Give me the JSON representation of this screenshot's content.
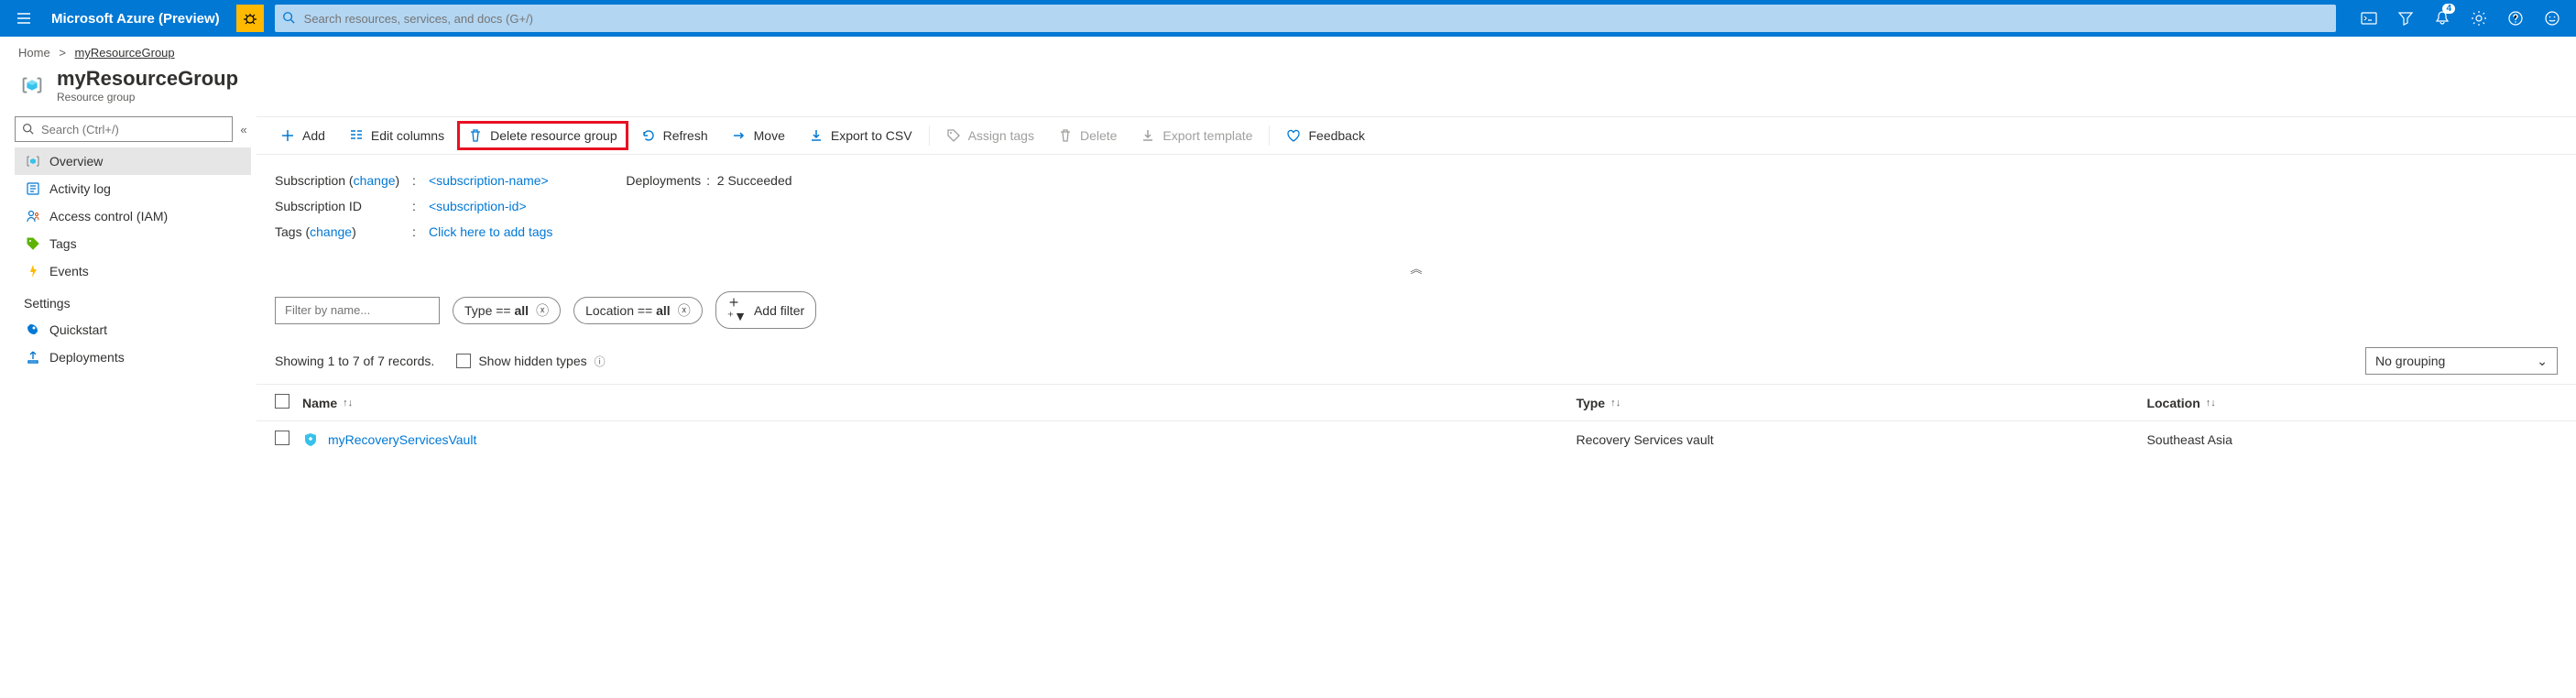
{
  "header": {
    "brand": "Microsoft Azure (Preview)",
    "search_placeholder": "Search resources, services, and docs (G+/)",
    "notification_count": "4"
  },
  "breadcrumb": {
    "home": "Home",
    "current": "myResourceGroup"
  },
  "page": {
    "title": "myResourceGroup",
    "subtitle": "Resource group"
  },
  "sidebar": {
    "search_placeholder": "Search (Ctrl+/)",
    "items": [
      {
        "label": "Overview"
      },
      {
        "label": "Activity log"
      },
      {
        "label": "Access control (IAM)"
      },
      {
        "label": "Tags"
      },
      {
        "label": "Events"
      }
    ],
    "section_settings": "Settings",
    "settings_items": [
      {
        "label": "Quickstart"
      },
      {
        "label": "Deployments"
      }
    ]
  },
  "toolbar": {
    "add": "Add",
    "edit_columns": "Edit columns",
    "delete_rg": "Delete resource group",
    "refresh": "Refresh",
    "move": "Move",
    "export_csv": "Export to CSV",
    "assign_tags": "Assign tags",
    "delete": "Delete",
    "export_template": "Export template",
    "feedback": "Feedback"
  },
  "summary": {
    "subscription_label": "Subscription",
    "change_link": "change",
    "subscription_value": "<subscription-name>",
    "subscription_id_label": "Subscription ID",
    "subscription_id_value": "<subscription-id>",
    "tags_label": "Tags",
    "tags_value": "Click here to add tags",
    "deployments_label": "Deployments",
    "deployments_value": "2 Succeeded"
  },
  "filters": {
    "filter_placeholder": "Filter by name...",
    "type_pill_prefix": "Type == ",
    "type_pill_value": "all",
    "location_pill_prefix": "Location == ",
    "location_pill_value": "all",
    "add_filter": "Add filter"
  },
  "records": {
    "showing": "Showing 1 to 7 of 7 records.",
    "show_hidden": "Show hidden types",
    "grouping": "No grouping"
  },
  "table": {
    "col_name": "Name",
    "col_type": "Type",
    "col_location": "Location",
    "rows": [
      {
        "name": "myRecoveryServicesVault",
        "type": "Recovery Services vault",
        "location": "Southeast Asia"
      }
    ]
  }
}
